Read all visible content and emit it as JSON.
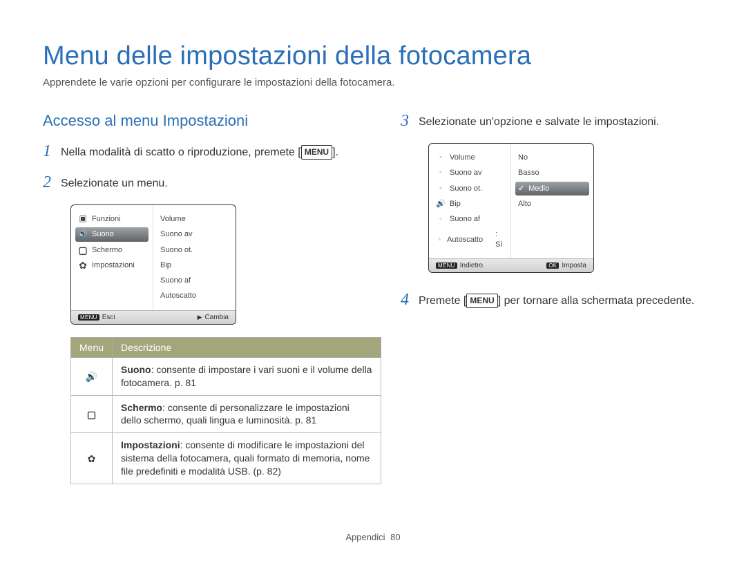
{
  "title": "Menu delle impostazioni della fotocamera",
  "intro": "Apprendete le varie opzioni per configurare le impostazioni della fotocamera.",
  "section_heading": "Accesso al menu Impostazioni",
  "menu_label": "MENU",
  "steps": {
    "s1": {
      "num": "1",
      "pre": "Nella modalità di scatto o riproduzione, premete [",
      "post": "]."
    },
    "s2": {
      "num": "2",
      "text": "Selezionate un menu."
    },
    "s3": {
      "num": "3",
      "text": "Selezionate un'opzione e salvate le impostazioni."
    },
    "s4": {
      "num": "4",
      "pre": "Premete [",
      "post": "] per tornare alla schermata precedente."
    }
  },
  "cam1": {
    "left": {
      "items": [
        {
          "icon": "camera",
          "label": "Funzioni"
        },
        {
          "icon": "speaker",
          "label": "Suono",
          "selected": true
        },
        {
          "icon": "screen",
          "label": "Schermo"
        },
        {
          "icon": "gear",
          "label": "Impostazioni"
        }
      ]
    },
    "right": {
      "items": [
        "Volume",
        "Suono av",
        "Suono ot.",
        "Bip",
        "Suono af",
        "Autoscatto"
      ]
    },
    "footer": {
      "left_tag": "MENU",
      "left": "Esci",
      "right_glyph": "▶",
      "right": "Cambia"
    }
  },
  "cam2": {
    "left": {
      "indicator_icon": "speaker",
      "items": [
        "Volume",
        "Suono av",
        "Suono ot.",
        "Bip",
        "Suono af",
        "Autoscatto"
      ],
      "extra_value": ": Sì"
    },
    "right": {
      "items": [
        {
          "label": "No"
        },
        {
          "label": "Basso"
        },
        {
          "label": "Medio",
          "selected": true,
          "checked": true
        },
        {
          "label": "Alto"
        }
      ]
    },
    "footer": {
      "left_tag": "MENU",
      "left": "Indietro",
      "right_tag": "OK",
      "right": "Imposta"
    }
  },
  "desc_table": {
    "headers": {
      "col1": "Menu",
      "col2": "Descrizione"
    },
    "rows": [
      {
        "icon": "speaker",
        "bold": "Suono",
        "text": ": consente di impostare i vari suoni e il volume della fotocamera. p. 81"
      },
      {
        "icon": "screen",
        "bold": "Schermo",
        "text": ": consente di personalizzare le impostazioni dello schermo, quali lingua e luminosità. p. 81"
      },
      {
        "icon": "gear",
        "bold": "Impostazioni",
        "text": ": consente di modificare le impostazioni del sistema della fotocamera, quali formato di memoria, nome file predefiniti e modalità USB. (p. 82)"
      }
    ]
  },
  "footer": {
    "section": "Appendici",
    "page": "80"
  }
}
